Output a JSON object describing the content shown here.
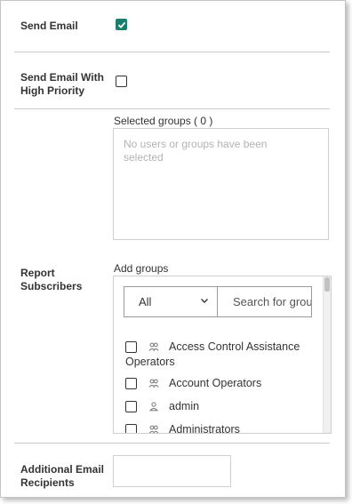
{
  "send_email": {
    "label": "Send Email",
    "checked": true
  },
  "high_priority": {
    "label_line1": "Send Email With",
    "label_line2": "High Priority",
    "checked": false
  },
  "report_subscribers": {
    "label_line1": "Report",
    "label_line2": "Subscribers",
    "selected_groups_label": "Selected groups ( 0 )",
    "selected_placeholder": "No users or groups have been selected",
    "add_groups_label": "Add groups",
    "filter_select_value": "All",
    "search_placeholder": "Search for groups",
    "items": [
      {
        "line1": "Access Control Assistance",
        "line2": "Operators",
        "icon": "group-icon",
        "checked": false
      },
      {
        "line1": "Account Operators",
        "icon": "group-icon",
        "checked": false
      },
      {
        "line1": "admin",
        "icon": "user-icon",
        "checked": false
      },
      {
        "line1": "Administrators",
        "icon": "group-icon",
        "checked": false
      }
    ]
  },
  "additional_email": {
    "label_line1": "Additional Email",
    "label_line2": "Recipients",
    "value": ""
  },
  "colors": {
    "accent": "#1b7f6c",
    "border": "#cfcfcf",
    "placeholder": "#b3b3b3"
  }
}
